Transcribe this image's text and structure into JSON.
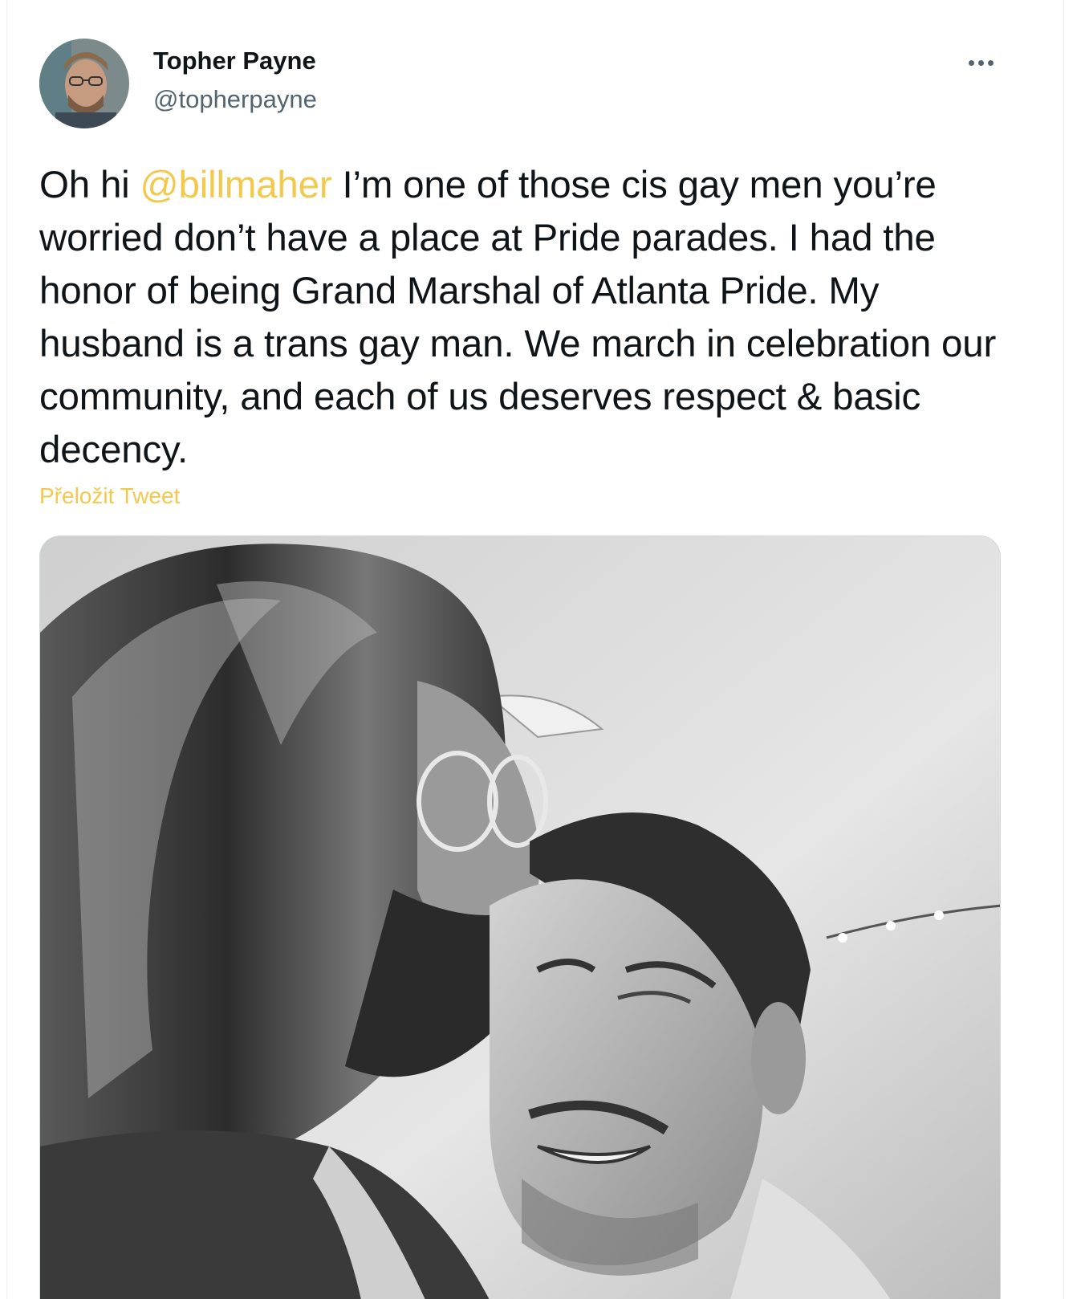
{
  "tweet": {
    "author": {
      "display_name": "Topher Payne",
      "handle": "@topherpayne",
      "avatar_icon": "user-avatar-photo"
    },
    "more_icon": "more-options-icon",
    "text_prefix": "Oh hi ",
    "mention": "@billmaher",
    "text_suffix": " I’m one of those cis gay men you’re worried don’t have a place at Pride parades. I had the honor of being Grand Marshal of Atlanta Pride. My husband is a trans gay man. We march in celebration our community, and each of us deserves respect & basic decency.",
    "translate_label": "Přeložit Tweet",
    "media_icon": "attached-photo-black-and-white"
  },
  "colors": {
    "accent": "#f2c94c",
    "text": "#0f1419",
    "secondary": "#536471"
  }
}
